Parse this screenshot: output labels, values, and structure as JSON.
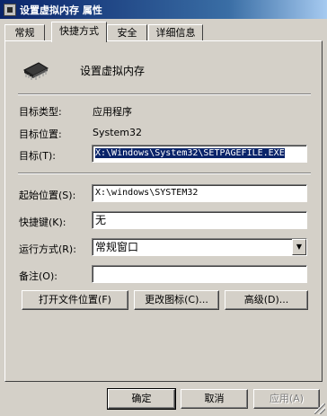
{
  "window": {
    "title": "设置虚拟内存 属性"
  },
  "tabs": [
    {
      "label": "常规"
    },
    {
      "label": "快捷方式",
      "active": true
    },
    {
      "label": "安全"
    },
    {
      "label": "详细信息"
    }
  ],
  "shortcut": {
    "name": "设置虚拟内存",
    "target_type_label": "目标类型:",
    "target_type_value": "应用程序",
    "target_location_label": "目标位置:",
    "target_location_value": "System32",
    "target_label": "目标(T):",
    "target_value": "X:\\Windows\\System32\\SETPAGEFILE.EXE",
    "start_in_label": "起始位置(S):",
    "start_in_value": "X:\\windows\\SYSTEM32",
    "hotkey_label": "快捷键(K):",
    "hotkey_value": "无",
    "run_label": "运行方式(R):",
    "run_value": "常规窗口",
    "comment_label": "备注(O):",
    "comment_value": ""
  },
  "buttons": {
    "open_location": "打开文件位置(F)",
    "change_icon": "更改图标(C)...",
    "advanced": "高级(D)..."
  },
  "footer": {
    "ok": "确定",
    "cancel": "取消",
    "apply": "应用(A)"
  }
}
